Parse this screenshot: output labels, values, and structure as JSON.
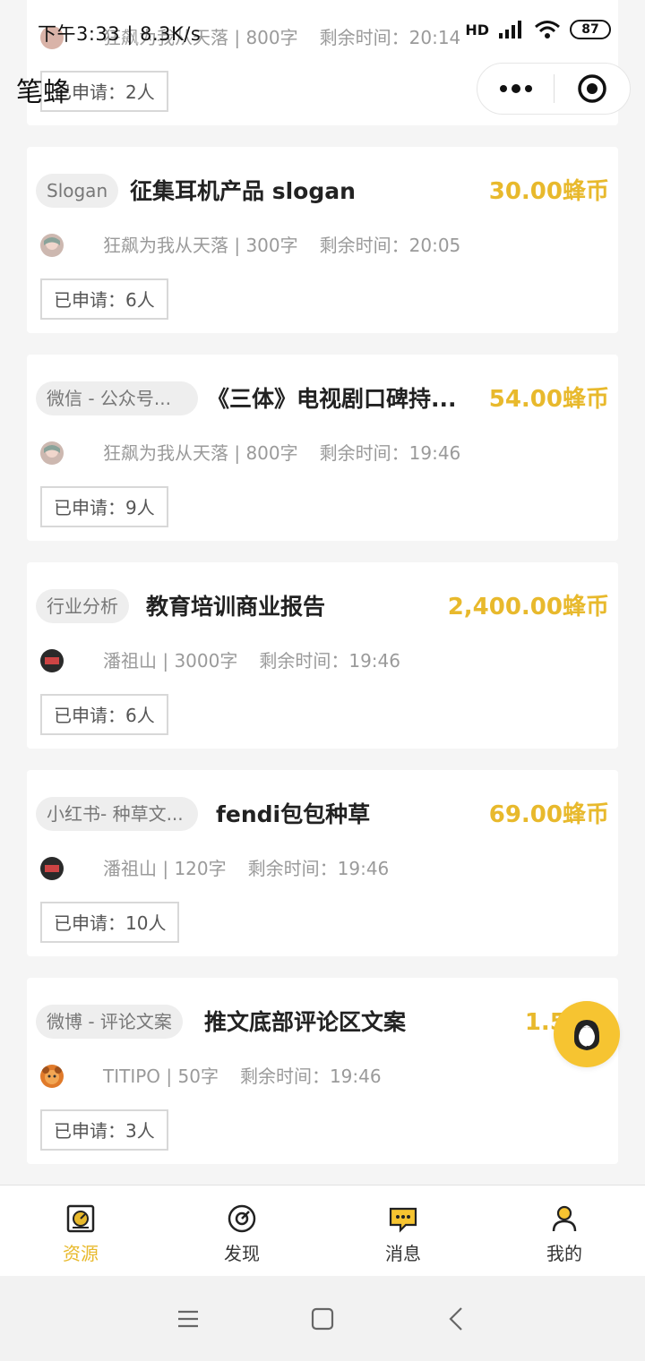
{
  "status_bar": {
    "time_network": "下午3:33 | 8.3K/s",
    "signal_label": "HD",
    "battery": "87"
  },
  "app": {
    "title": "笔蜂"
  },
  "cards": [
    {
      "author": "狂飙为我从天落",
      "words": "800字",
      "remaining_label": "剩余时间：",
      "remaining": "20:14",
      "applied": "已申请：2人"
    },
    {
      "tag": "Slogan",
      "title": "征集耳机产品 slogan",
      "price": "30.00蜂币",
      "author": "狂飙为我从天落",
      "words": "300字",
      "remaining_label": "剩余时间：",
      "remaining": "20:05",
      "applied": "已申请：6人"
    },
    {
      "tag": "微信 - 公众号...",
      "title": "《三体》电视剧口碑持...",
      "price": "54.00蜂币",
      "author": "狂飙为我从天落",
      "words": "800字",
      "remaining_label": "剩余时间：",
      "remaining": "19:46",
      "applied": "已申请：9人"
    },
    {
      "tag": "行业分析",
      "title": "教育培训商业报告",
      "price": "2,400.00蜂币",
      "author": "潘祖山",
      "words": "3000字",
      "remaining_label": "剩余时间：",
      "remaining": "19:46",
      "applied": "已申请：6人"
    },
    {
      "tag": "小红书- 种草文...",
      "title": "fendi包包种草",
      "price": "69.00蜂币",
      "author": "潘祖山",
      "words": "120字",
      "remaining_label": "剩余时间：",
      "remaining": "19:46",
      "applied": "已申请：10人"
    },
    {
      "tag": "微博 - 评论文案",
      "title": "推文底部评论区文案",
      "price": "1.50",
      "author": "TITIPO",
      "words": "50字",
      "remaining_label": "剩余时间：",
      "remaining": "19:46",
      "applied": "已申请：3人"
    }
  ],
  "tabs": [
    {
      "label": "资源",
      "icon": "resource-icon",
      "active": true
    },
    {
      "label": "发现",
      "icon": "discover-icon",
      "active": false
    },
    {
      "label": "消息",
      "icon": "message-icon",
      "active": false
    },
    {
      "label": "我的",
      "icon": "profile-icon",
      "active": false
    }
  ],
  "colors": {
    "accent": "#e8b92c",
    "fab": "#f6c431",
    "text_dark": "#222222",
    "text_muted": "#9a9a9a"
  }
}
